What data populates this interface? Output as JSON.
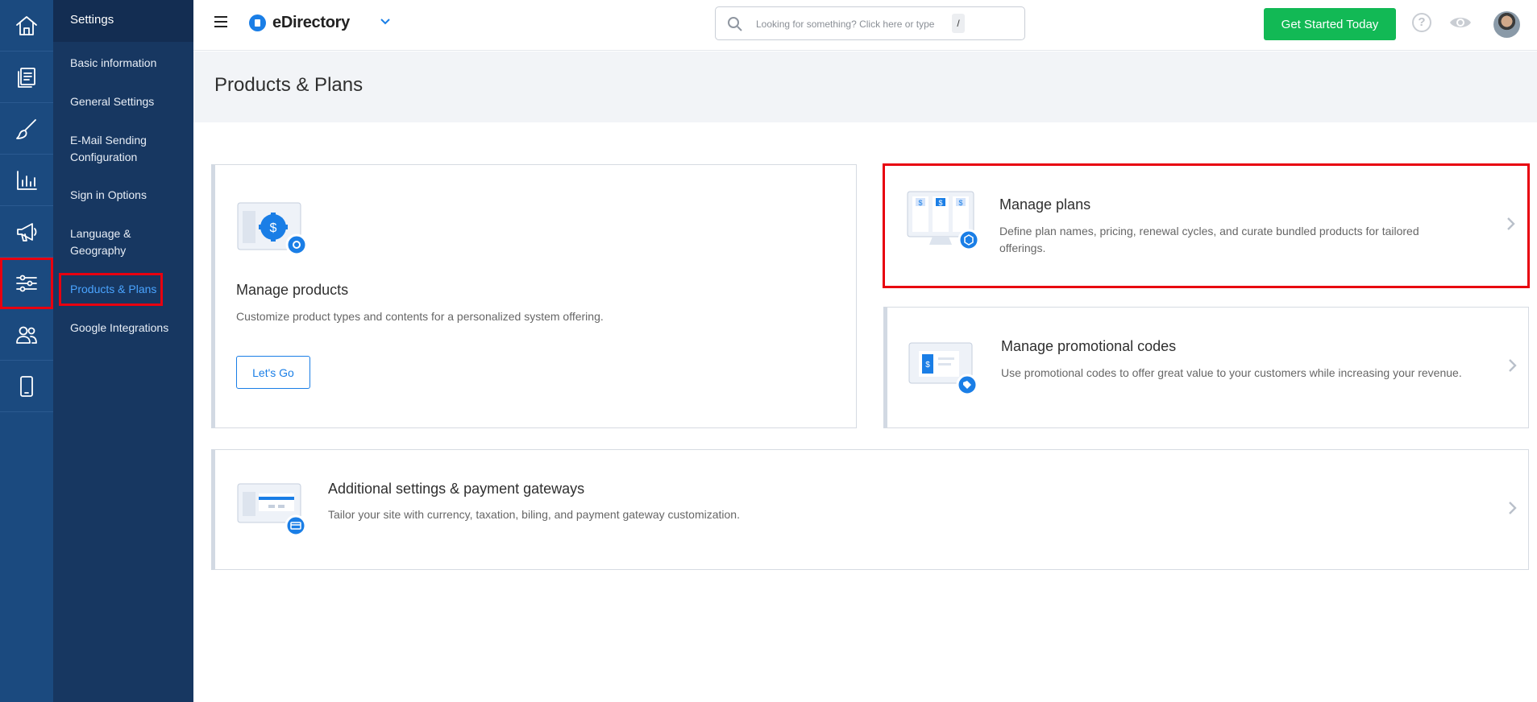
{
  "rail": {
    "items": [
      {
        "name": "home-icon"
      },
      {
        "name": "content-icon"
      },
      {
        "name": "design-icon"
      },
      {
        "name": "reports-icon"
      },
      {
        "name": "promotion-icon"
      },
      {
        "name": "settings-icon"
      },
      {
        "name": "users-icon"
      },
      {
        "name": "mobile-icon"
      }
    ],
    "accent_color": "#e8000f"
  },
  "submenu": {
    "title": "Settings",
    "items": [
      {
        "label": "Basic information"
      },
      {
        "label": "General Settings"
      },
      {
        "label": "E-Mail Sending Configuration"
      },
      {
        "label": "Sign in Options"
      },
      {
        "label": "Language & Geography"
      },
      {
        "label": "Products & Plans"
      },
      {
        "label": "Google Integrations"
      }
    ],
    "active_index": 5
  },
  "topbar": {
    "brand": "eDirectory",
    "search_placeholder": "Looking for something? Click here or type",
    "search_shortcut": "/",
    "cta_label": "Get Started Today",
    "help_glyph": "?",
    "cta_color": "#12b955"
  },
  "page": {
    "title": "Products & Plans"
  },
  "cards": {
    "products": {
      "title": "Manage products",
      "description": "Customize product types and contents for a personalized system offering.",
      "button": "Let's Go"
    },
    "plans": {
      "title": "Manage plans",
      "description": "Define plan names, pricing, renewal cycles, and curate bundled products for tailored offerings."
    },
    "promo": {
      "title": "Manage promotional codes",
      "description": "Use promotional codes to offer great value to your customers while increasing your revenue."
    },
    "additional": {
      "title": "Additional settings & payment gateways",
      "description": "Tailor your site with currency, taxation, biling, and payment gateway customization."
    },
    "illustration_glyph": "$"
  }
}
